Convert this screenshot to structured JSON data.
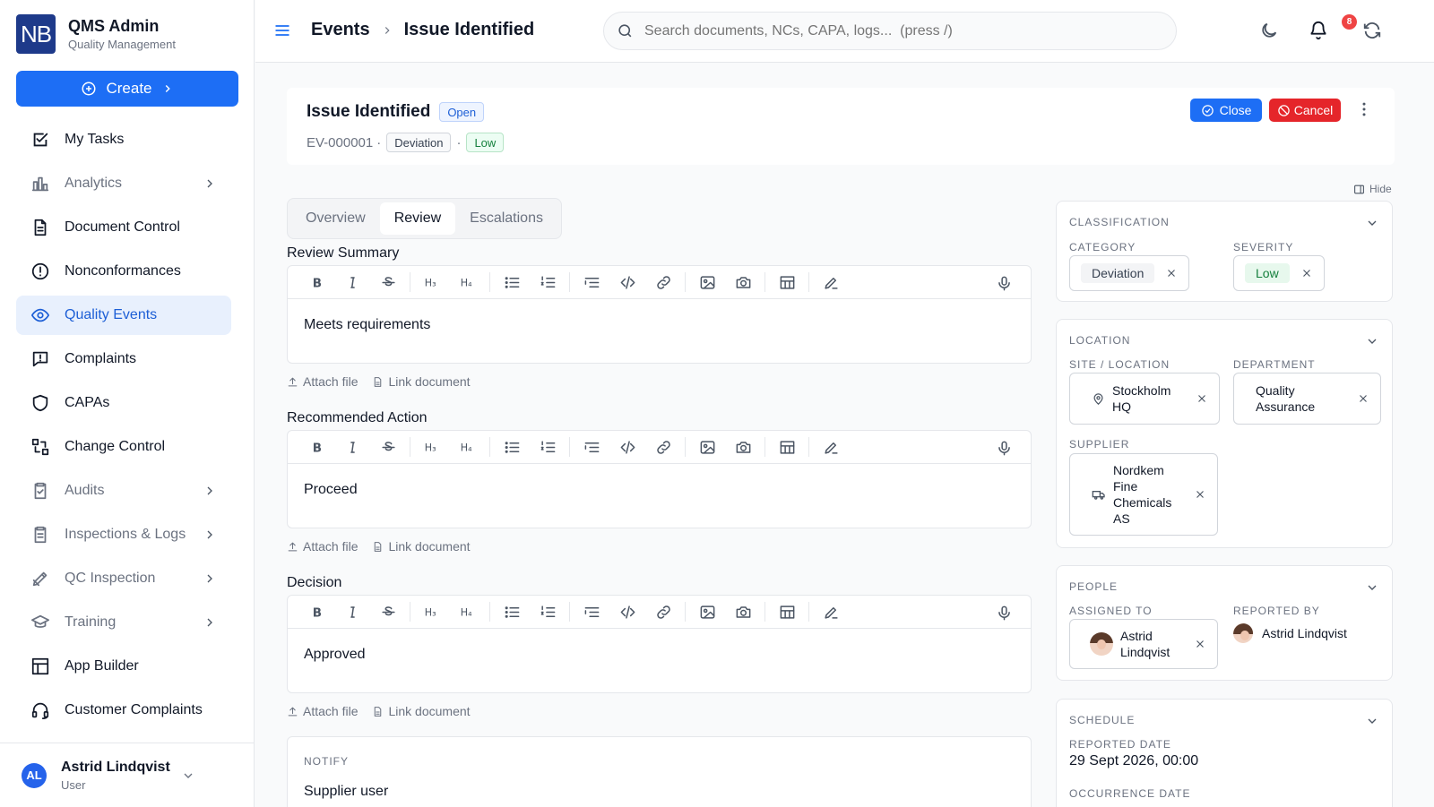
{
  "brand": {
    "logo": "NB",
    "title": "QMS Admin",
    "subtitle": "Quality Management"
  },
  "create_label": "Create",
  "nav": [
    {
      "label": "My Tasks",
      "icon": "check-square-icon",
      "dim": false,
      "chevron": false,
      "active": false
    },
    {
      "label": "Analytics",
      "icon": "bar-chart-icon",
      "dim": true,
      "chevron": true,
      "active": false
    },
    {
      "label": "Document Control",
      "icon": "document-icon",
      "dim": false,
      "chevron": false,
      "active": false
    },
    {
      "label": "Nonconformances",
      "icon": "alert-circle-icon",
      "dim": false,
      "chevron": false,
      "active": false
    },
    {
      "label": "Quality Events",
      "icon": "eye-icon",
      "dim": false,
      "chevron": false,
      "active": true
    },
    {
      "label": "Complaints",
      "icon": "message-alert-icon",
      "dim": false,
      "chevron": false,
      "active": false
    },
    {
      "label": "CAPAs",
      "icon": "shield-icon",
      "dim": false,
      "chevron": false,
      "active": false
    },
    {
      "label": "Change Control",
      "icon": "git-compare-icon",
      "dim": false,
      "chevron": false,
      "active": false
    },
    {
      "label": "Audits",
      "icon": "clipboard-check-icon",
      "dim": true,
      "chevron": true,
      "active": false
    },
    {
      "label": "Inspections & Logs",
      "icon": "clipboard-list-icon",
      "dim": true,
      "chevron": true,
      "active": false
    },
    {
      "label": "QC Inspection",
      "icon": "ruler-pencil-icon",
      "dim": true,
      "chevron": true,
      "active": false
    },
    {
      "label": "Training",
      "icon": "graduation-cap-icon",
      "dim": true,
      "chevron": true,
      "active": false
    },
    {
      "label": "App Builder",
      "icon": "grid-layout-icon",
      "dim": false,
      "chevron": false,
      "active": false
    },
    {
      "label": "Customer Complaints",
      "icon": "headset-icon",
      "dim": false,
      "chevron": false,
      "active": false
    }
  ],
  "user": {
    "initials": "AL",
    "name": "Astrid Lindqvist",
    "role": "User"
  },
  "topbar": {
    "crumb_parent": "Events",
    "crumb_current": "Issue Identified",
    "search_placeholder": "Search documents, NCs, CAPA, logs...  (press /)",
    "notification_count": "8"
  },
  "header": {
    "title": "Issue Identified",
    "status": "Open",
    "id": "EV-000001",
    "dot": "·",
    "category": "Deviation",
    "severity": "Low",
    "close_label": "Close",
    "cancel_label": "Cancel",
    "hide_label": "Hide"
  },
  "tabs": [
    "Overview",
    "Review",
    "Escalations"
  ],
  "active_tab": 1,
  "editors": [
    {
      "label": "Review Summary",
      "content": "Meets requirements"
    },
    {
      "label": "Recommended Action",
      "content": "Proceed"
    },
    {
      "label": "Decision",
      "content": "Approved"
    }
  ],
  "attach": {
    "file_label": "Attach file",
    "link_label": "Link document"
  },
  "notify": {
    "title": "NOTIFY",
    "value": "Supplier user"
  },
  "classification": {
    "title": "CLASSIFICATION",
    "category_label": "CATEGORY",
    "category_value": "Deviation",
    "severity_label": "SEVERITY",
    "severity_value": "Low"
  },
  "location": {
    "title": "LOCATION",
    "site_label": "SITE / LOCATION",
    "site_value_1": "Stockholm",
    "site_value_2": "HQ",
    "dept_label": "DEPARTMENT",
    "dept_value_1": "Quality",
    "dept_value_2": "Assurance",
    "supplier_label": "SUPPLIER",
    "supplier_1": "Nordkem",
    "supplier_2": "Fine",
    "supplier_3": "Chemicals",
    "supplier_4": "AS"
  },
  "people": {
    "title": "PEOPLE",
    "assigned_label": "ASSIGNED TO",
    "assigned_1": "Astrid",
    "assigned_2": "Lindqvist",
    "reported_label": "REPORTED BY",
    "reported_value": "Astrid Lindqvist"
  },
  "schedule": {
    "title": "SCHEDULE",
    "reported_label": "REPORTED DATE",
    "reported_value": "29 Sept 2026, 00:00",
    "occurrence_label": "OCCURRENCE DATE"
  },
  "colors": {
    "primary": "#1d6ef5",
    "danger": "#e5252a",
    "active_bg": "#e8f0fd"
  }
}
